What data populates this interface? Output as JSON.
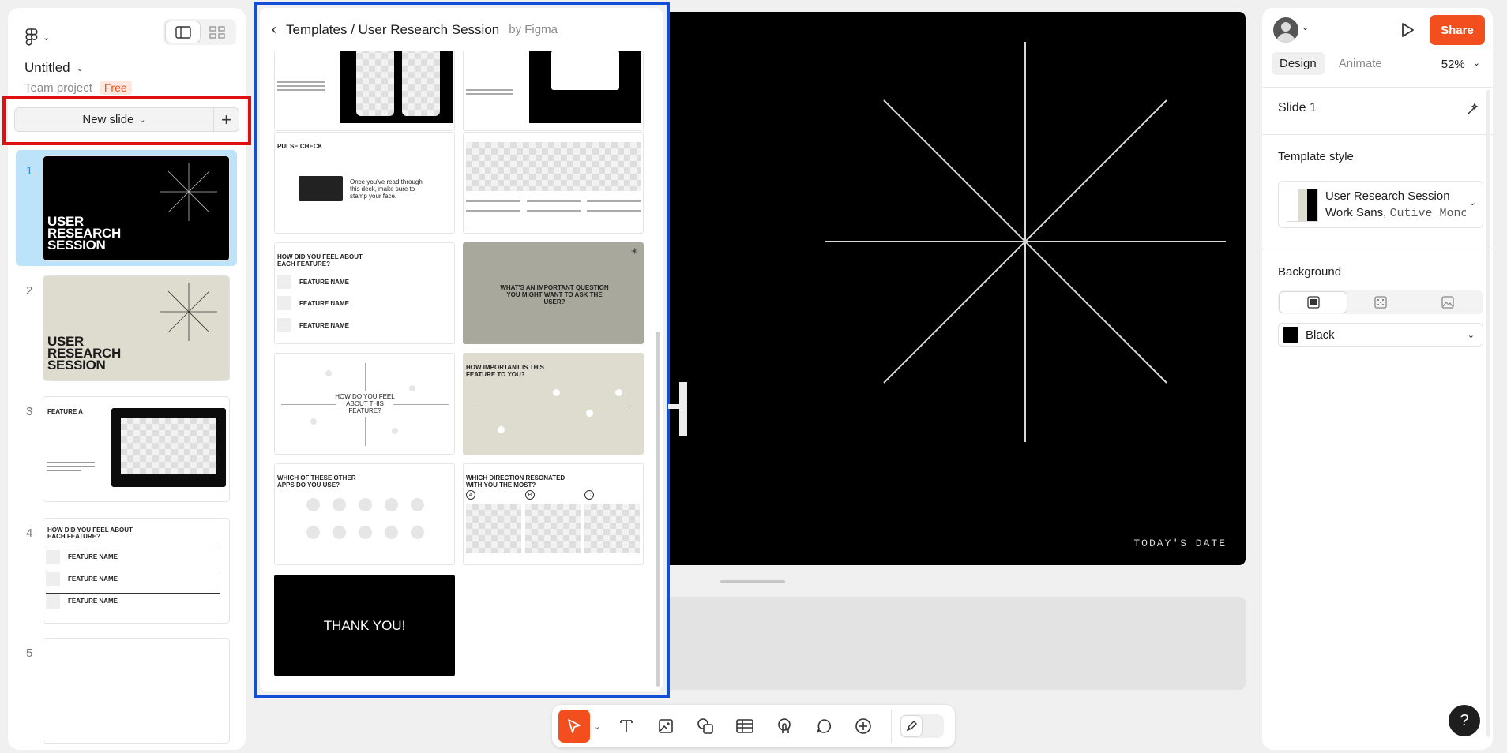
{
  "sidebar": {
    "project_title": "Untitled",
    "team_label": "Team project",
    "plan_badge": "Free",
    "new_slide_label": "New slide",
    "slides": [
      {
        "number": "1",
        "title": "USER\nRESEARCH\nSESSION"
      },
      {
        "number": "2",
        "title": "USER\nRESEARCH\nSESSION"
      },
      {
        "number": "3",
        "title": "FEATURE A"
      },
      {
        "number": "4",
        "title": "HOW DID YOU FEEL ABOUT\nEACH FEATURE?",
        "rows": [
          "FEATURE NAME",
          "FEATURE NAME",
          "FEATURE NAME"
        ]
      },
      {
        "number": "5"
      }
    ]
  },
  "template_panel": {
    "breadcrumb": "Templates / User Research Session",
    "by_label": "by Figma",
    "cards": {
      "pulse_check": {
        "title": "PULSE CHECK",
        "text": "Once you've read through this deck, make sure to stamp your face."
      },
      "feel_each": {
        "title": "HOW DID YOU FEEL ABOUT\nEACH FEATURE?",
        "rows": [
          "FEATURE NAME",
          "FEATURE NAME",
          "FEATURE NAME"
        ]
      },
      "question": {
        "title": "WHAT'S AN IMPORTANT QUESTION YOU MIGHT WANT TO ASK THE USER?"
      },
      "feel_this": {
        "title": "HOW DO YOU FEEL ABOUT THIS FEATURE?"
      },
      "important": {
        "title": "HOW IMPORTANT IS THIS\nFEATURE TO YOU?"
      },
      "other_apps": {
        "title": "WHICH OF THESE OTHER\nAPPS DO YOU USE?"
      },
      "direction": {
        "title": "WHICH DIRECTION RESONATED\nWITH YOU THE MOST?",
        "options": [
          "A",
          "B",
          "C"
        ]
      },
      "thanks": {
        "title": "THANK YOU!"
      }
    }
  },
  "canvas": {
    "date_text": "TODAY'S DATE"
  },
  "right_panel": {
    "share_label": "Share",
    "tab_design": "Design",
    "tab_animate": "Animate",
    "zoom": "52%",
    "slide_title": "Slide 1",
    "template_style_label": "Template style",
    "style_name": "User Research Session",
    "style_font_primary": "Work Sans",
    "style_font_secondary": "Cutive Mono",
    "background_label": "Background",
    "background_color_name": "Black",
    "help_label": "?"
  },
  "colors": {
    "accent": "#f24e1e",
    "selection": "#bde3fb",
    "highlight_red": "#e01010",
    "highlight_blue": "#1150d6",
    "beige": "#dddccf"
  }
}
